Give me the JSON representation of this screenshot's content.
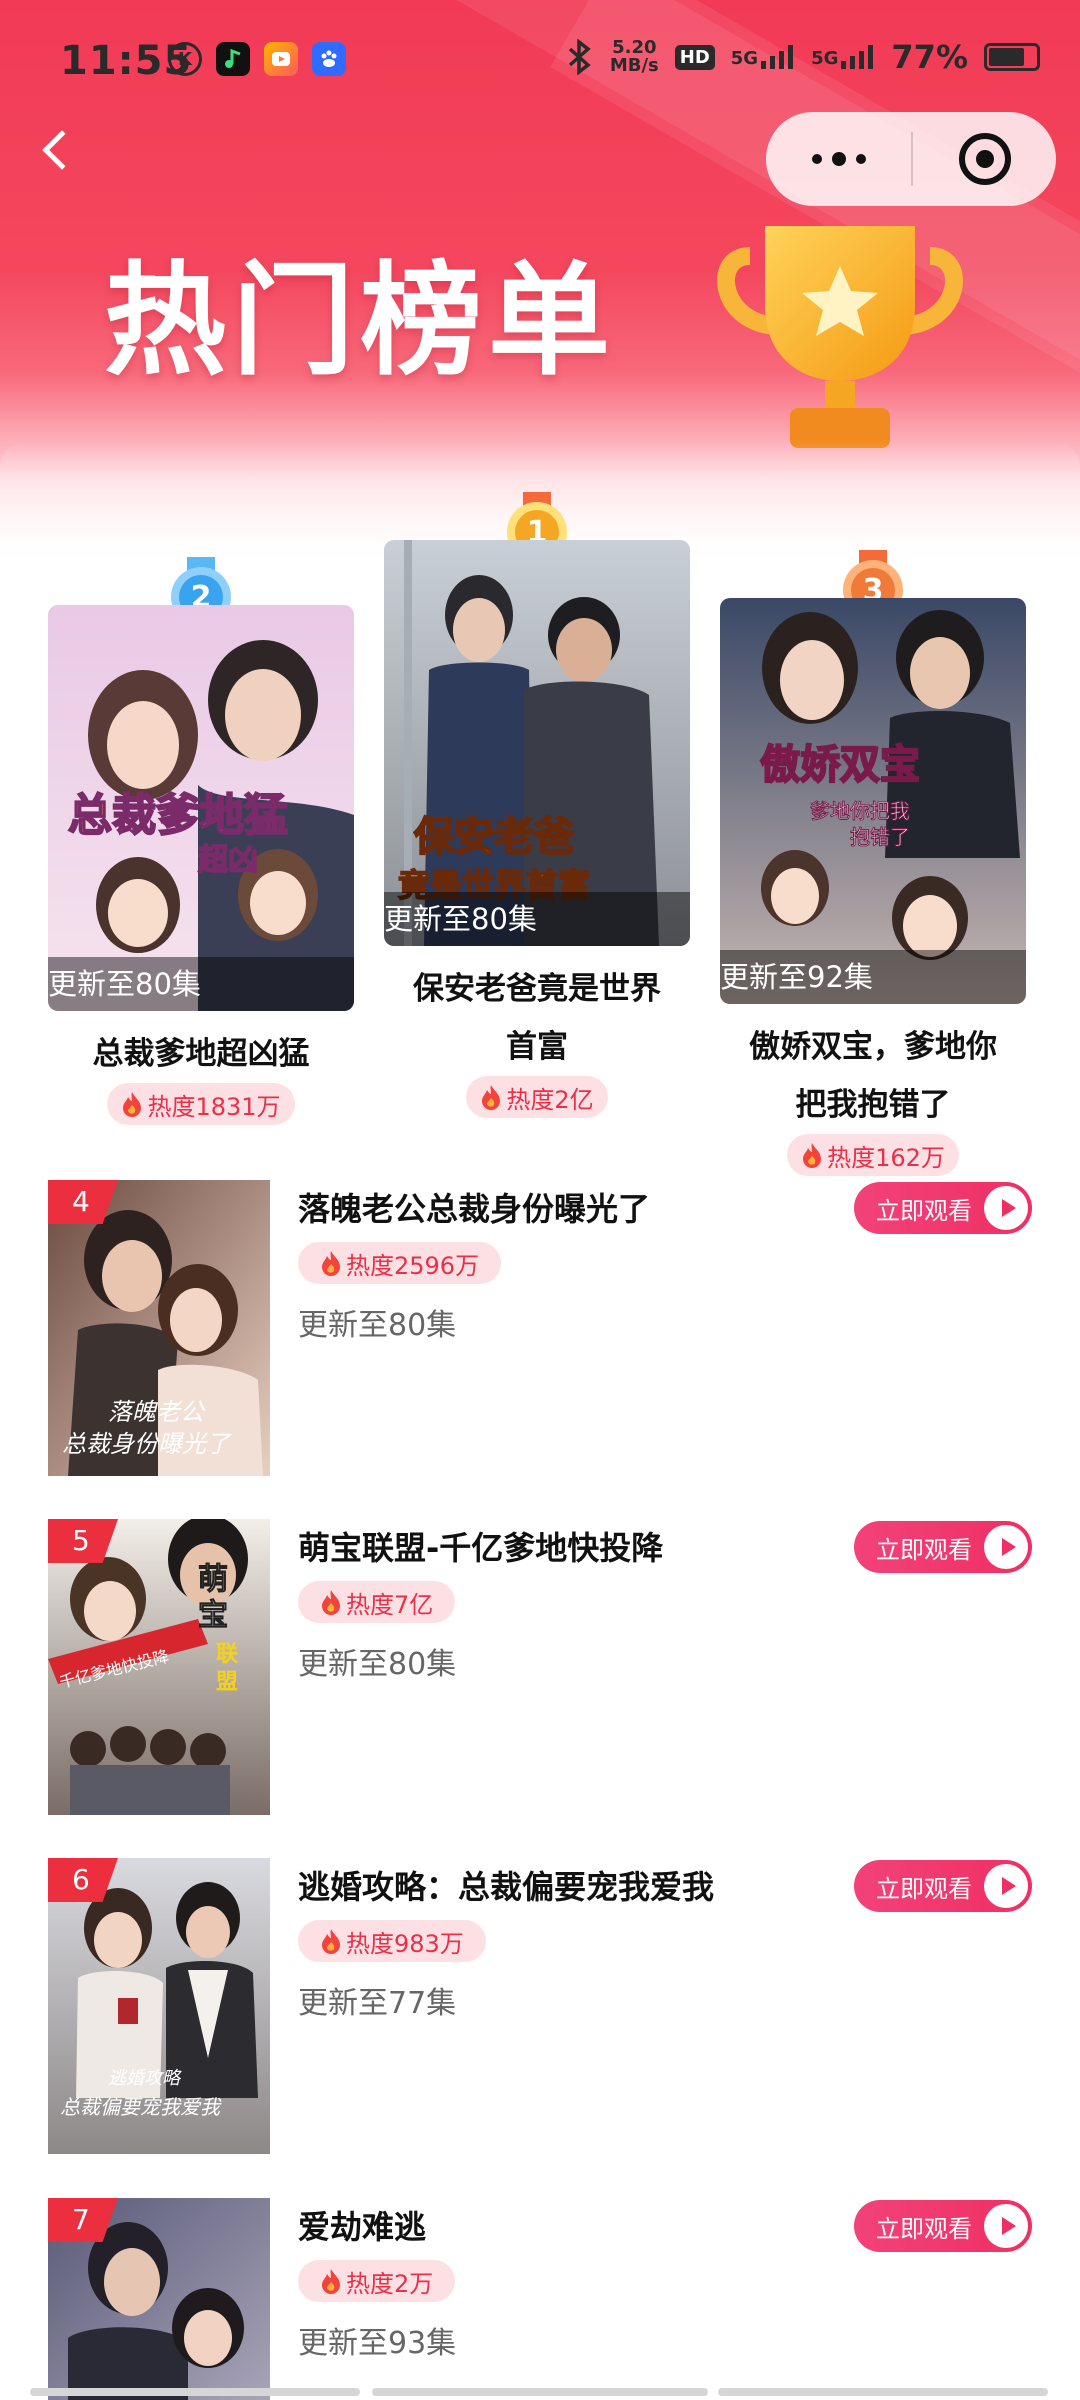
{
  "status_bar": {
    "time": "11:55",
    "speed_top": "5.20",
    "speed_unit": "MB/s",
    "hd_label": "HD",
    "signal_1": "5G",
    "signal_2": "5G",
    "battery": "77%"
  },
  "header": {
    "title": "热门榜单"
  },
  "colors": {
    "primary": "#f23a56",
    "accent_pink": "#ef2f63",
    "heat_bg": "#fde0e4",
    "heat_text": "#e8304a",
    "rank_badge": "#ec2f3e",
    "medal_gold": "#f5a623",
    "medal_blue": "#3aa3f0",
    "medal_orange": "#f07a3a"
  },
  "top3": [
    {
      "rank": "2",
      "medal_icon": "medal-silver-icon",
      "episodes": "更新至80集",
      "title_line1": "总裁爹地超凶猛",
      "title_line2": "",
      "heat": "热度1831万"
    },
    {
      "rank": "1",
      "medal_icon": "medal-gold-icon",
      "episodes": "更新至80集",
      "title_line1": "保安老爸竟是世界",
      "title_line2": "首富",
      "heat": "热度2亿"
    },
    {
      "rank": "3",
      "medal_icon": "medal-bronze-icon",
      "episodes": "更新至92集",
      "title_line1": "傲娇双宝，爹地你",
      "title_line2": "把我抱错了",
      "heat": "热度162万"
    }
  ],
  "list": [
    {
      "rank": "4",
      "title": "落魄老公总裁身份曝光了",
      "heat": "热度2596万",
      "episodes": "更新至80集",
      "action": "立即观看"
    },
    {
      "rank": "5",
      "title": "萌宝联盟-千亿爹地快投降",
      "heat": "热度7亿",
      "episodes": "更新至80集",
      "action": "立即观看"
    },
    {
      "rank": "6",
      "title": "逃婚攻略：总裁偏要宠我爱我",
      "heat": "热度983万",
      "episodes": "更新至77集",
      "action": "立即观看"
    },
    {
      "rank": "7",
      "title": "爱劫难逃",
      "heat": "热度2万",
      "episodes": "更新至93集",
      "action": "立即观看"
    }
  ]
}
